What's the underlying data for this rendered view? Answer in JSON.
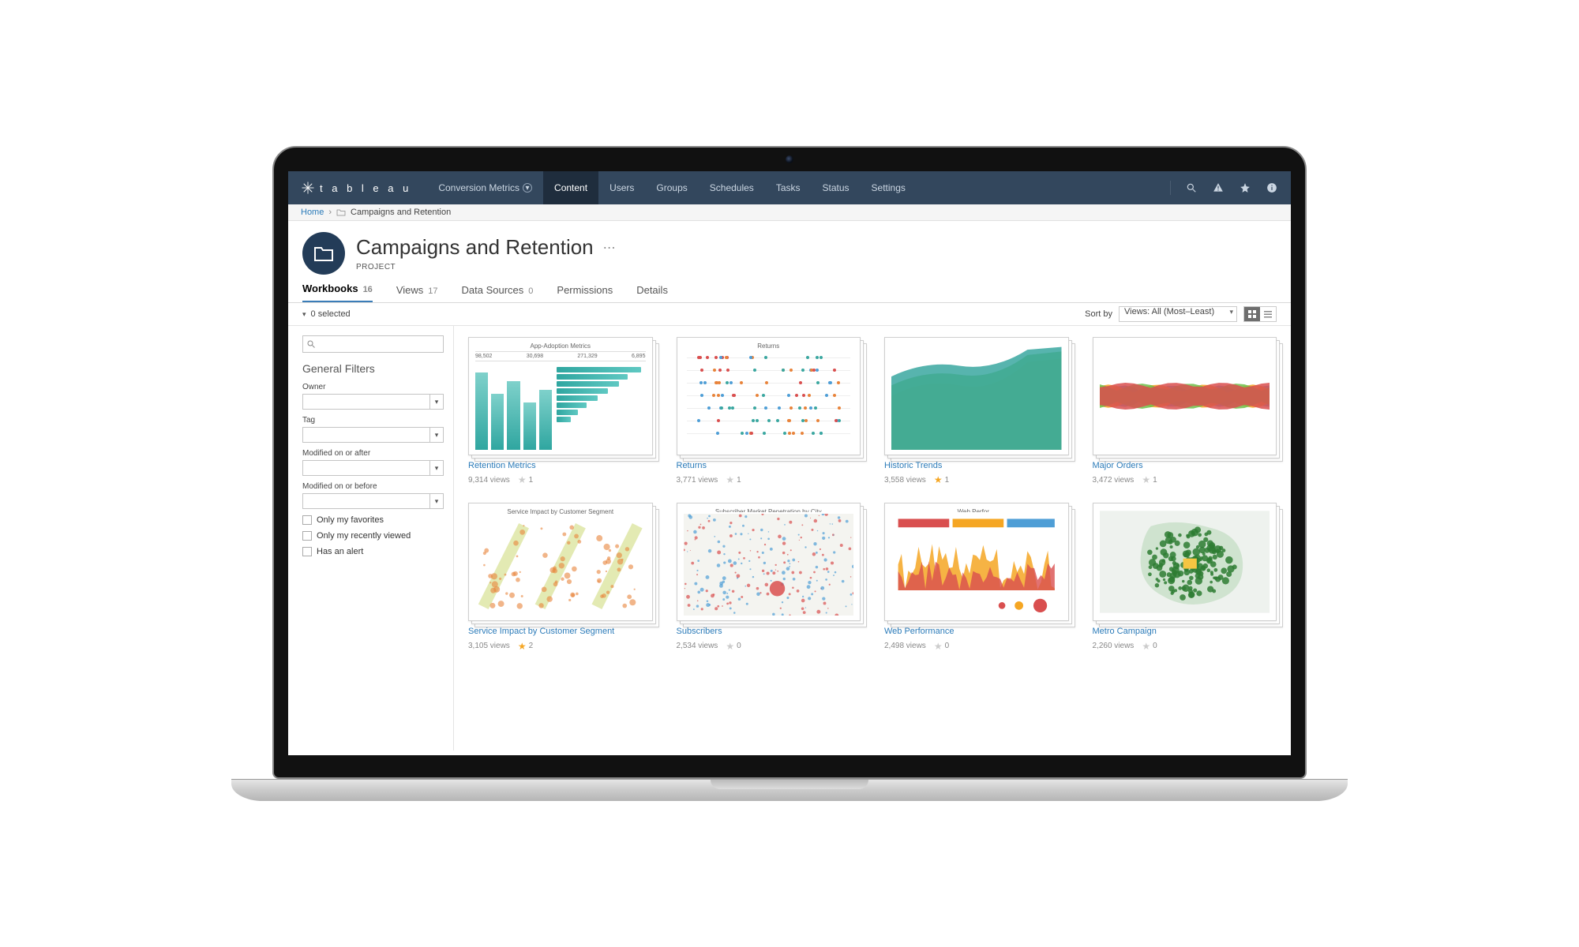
{
  "brand": "t a b l e a u",
  "site_picker": "Conversion Metrics",
  "nav": {
    "items": [
      "Content",
      "Users",
      "Groups",
      "Schedules",
      "Tasks",
      "Status",
      "Settings"
    ],
    "active_index": 0
  },
  "breadcrumb": {
    "home": "Home",
    "current": "Campaigns and Retention"
  },
  "page": {
    "title": "Campaigns and Retention",
    "subtitle": "PROJECT"
  },
  "tabs": [
    {
      "label": "Workbooks",
      "count": "16",
      "active": true
    },
    {
      "label": "Views",
      "count": "17",
      "active": false
    },
    {
      "label": "Data Sources",
      "count": "0",
      "active": false
    },
    {
      "label": "Permissions",
      "count": "",
      "active": false
    },
    {
      "label": "Details",
      "count": "",
      "active": false
    }
  ],
  "subbar": {
    "selected_text": "0 selected",
    "sort_label": "Sort by",
    "sort_value": "Views: All (Most–Least)"
  },
  "filters": {
    "heading": "General Filters",
    "owner_label": "Owner",
    "tag_label": "Tag",
    "mod_after_label": "Modified on or after",
    "mod_before_label": "Modified on or before",
    "only_favorites": "Only my favorites",
    "only_recent": "Only my recently viewed",
    "has_alert": "Has an alert"
  },
  "workbooks": [
    {
      "name": "Retention Metrics",
      "views": "9,314 views",
      "fav_count": "1",
      "fav": false,
      "thumb_label": "App-Adoption Metrics",
      "viz": "bars"
    },
    {
      "name": "Returns",
      "views": "3,771 views",
      "fav_count": "1",
      "fav": false,
      "thumb_label": "Returns",
      "viz": "dots"
    },
    {
      "name": "Historic Trends",
      "views": "3,558 views",
      "fav_count": "1",
      "fav": true,
      "thumb_label": "",
      "viz": "area"
    },
    {
      "name": "Major Orders",
      "views": "3,472 views",
      "fav_count": "1",
      "fav": false,
      "thumb_label": "",
      "viz": "mirror"
    },
    {
      "name": "Service Impact by Customer Segment",
      "views": "3,105 views",
      "fav_count": "2",
      "fav": true,
      "thumb_label": "Service Impact by Customer Segment",
      "viz": "scatter3"
    },
    {
      "name": "Subscribers",
      "views": "2,534 views",
      "fav_count": "0",
      "fav": false,
      "thumb_label": "Subscriber Market Penetration by City",
      "viz": "pointmap"
    },
    {
      "name": "Web Performance",
      "views": "2,498 views",
      "fav_count": "0",
      "fav": false,
      "thumb_label": "Web Perfor…",
      "viz": "spikes"
    },
    {
      "name": "Metro Campaign",
      "views": "2,260 views",
      "fav_count": "0",
      "fav": false,
      "thumb_label": "",
      "viz": "greenmap"
    }
  ]
}
